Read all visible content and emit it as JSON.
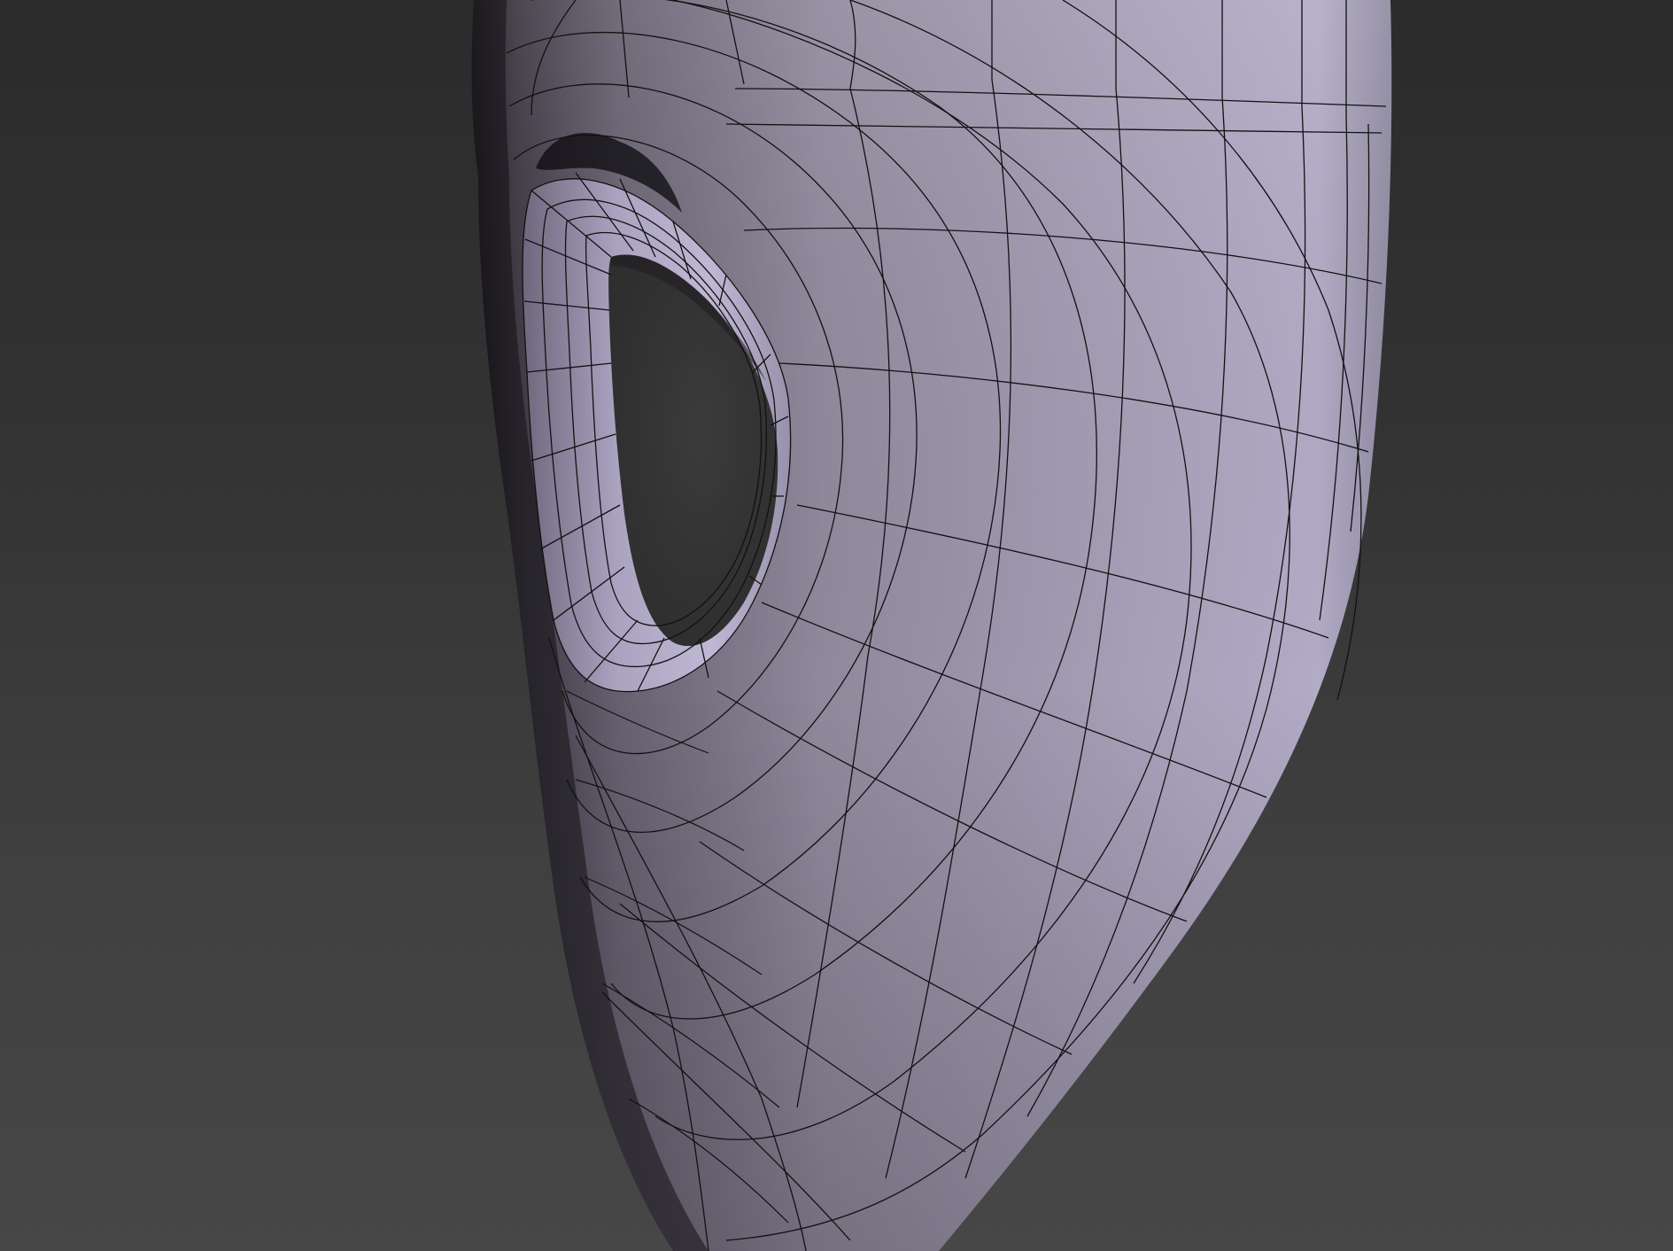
{
  "viewport": {
    "background_top": "#2b2b2b",
    "background_bottom": "#474747",
    "shaded_object": "3d-mesh-with-wireframe",
    "surface_color": "#aaa2bf",
    "surface_shadow_color": "#5f596d",
    "wire_color": "#111111",
    "hole_color": "#3a3a3a"
  }
}
